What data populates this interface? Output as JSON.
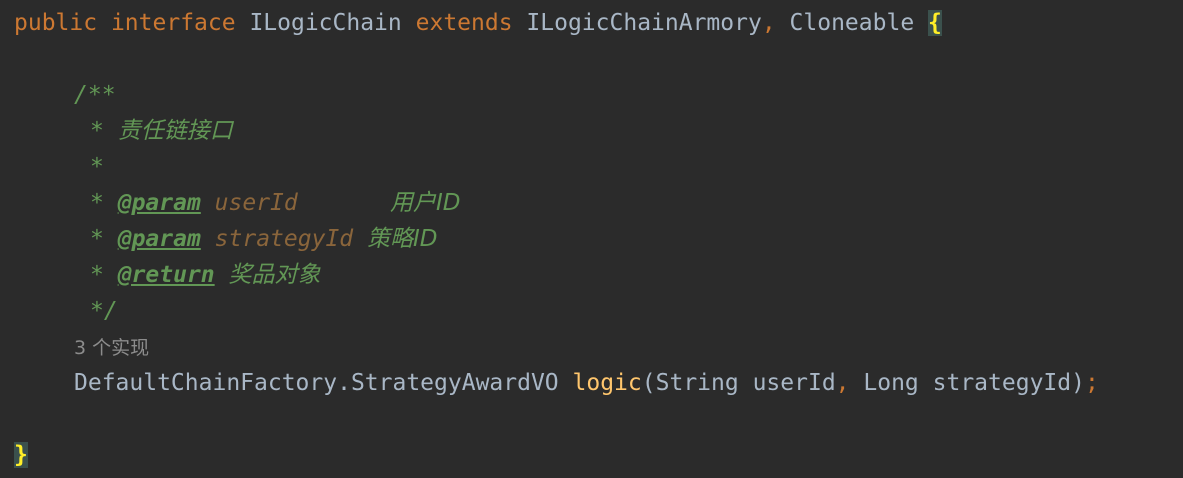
{
  "code": {
    "decl": {
      "kw_public": "public",
      "kw_interface": "interface",
      "name": "ILogicChain",
      "kw_extends": "extends",
      "parent1": "ILogicChainArmory",
      "comma": ",",
      "parent2": "Cloneable",
      "open_brace": "{"
    },
    "javadoc": {
      "open": "/**",
      "star": "*",
      "summary": "责任链接口",
      "param_tag": "@param",
      "param1_name": "userId",
      "param1_desc": "用户ID",
      "param2_name": "strategyId",
      "param2_desc": "策略ID",
      "return_tag": "@return",
      "return_desc": "奖品对象",
      "close": "*/"
    },
    "usage_hint": "3 个实现",
    "method": {
      "return_type": "DefaultChainFactory.StrategyAwardVO",
      "name": "logic",
      "open_paren": "(",
      "param1_type": "String",
      "param1_name": "userId",
      "comma": ",",
      "param2_type": "Long",
      "param2_name": "strategyId",
      "close_paren": ")",
      "semicolon": ";"
    },
    "close_brace": "}"
  },
  "colors": {
    "background": "#2b2b2b",
    "keyword": "#cc7832",
    "identifier": "#a9b7c6",
    "method_name": "#ffc66d",
    "doc_comment": "#629755",
    "doc_param": "#8a653b",
    "brace_highlight": "#ffef28"
  }
}
